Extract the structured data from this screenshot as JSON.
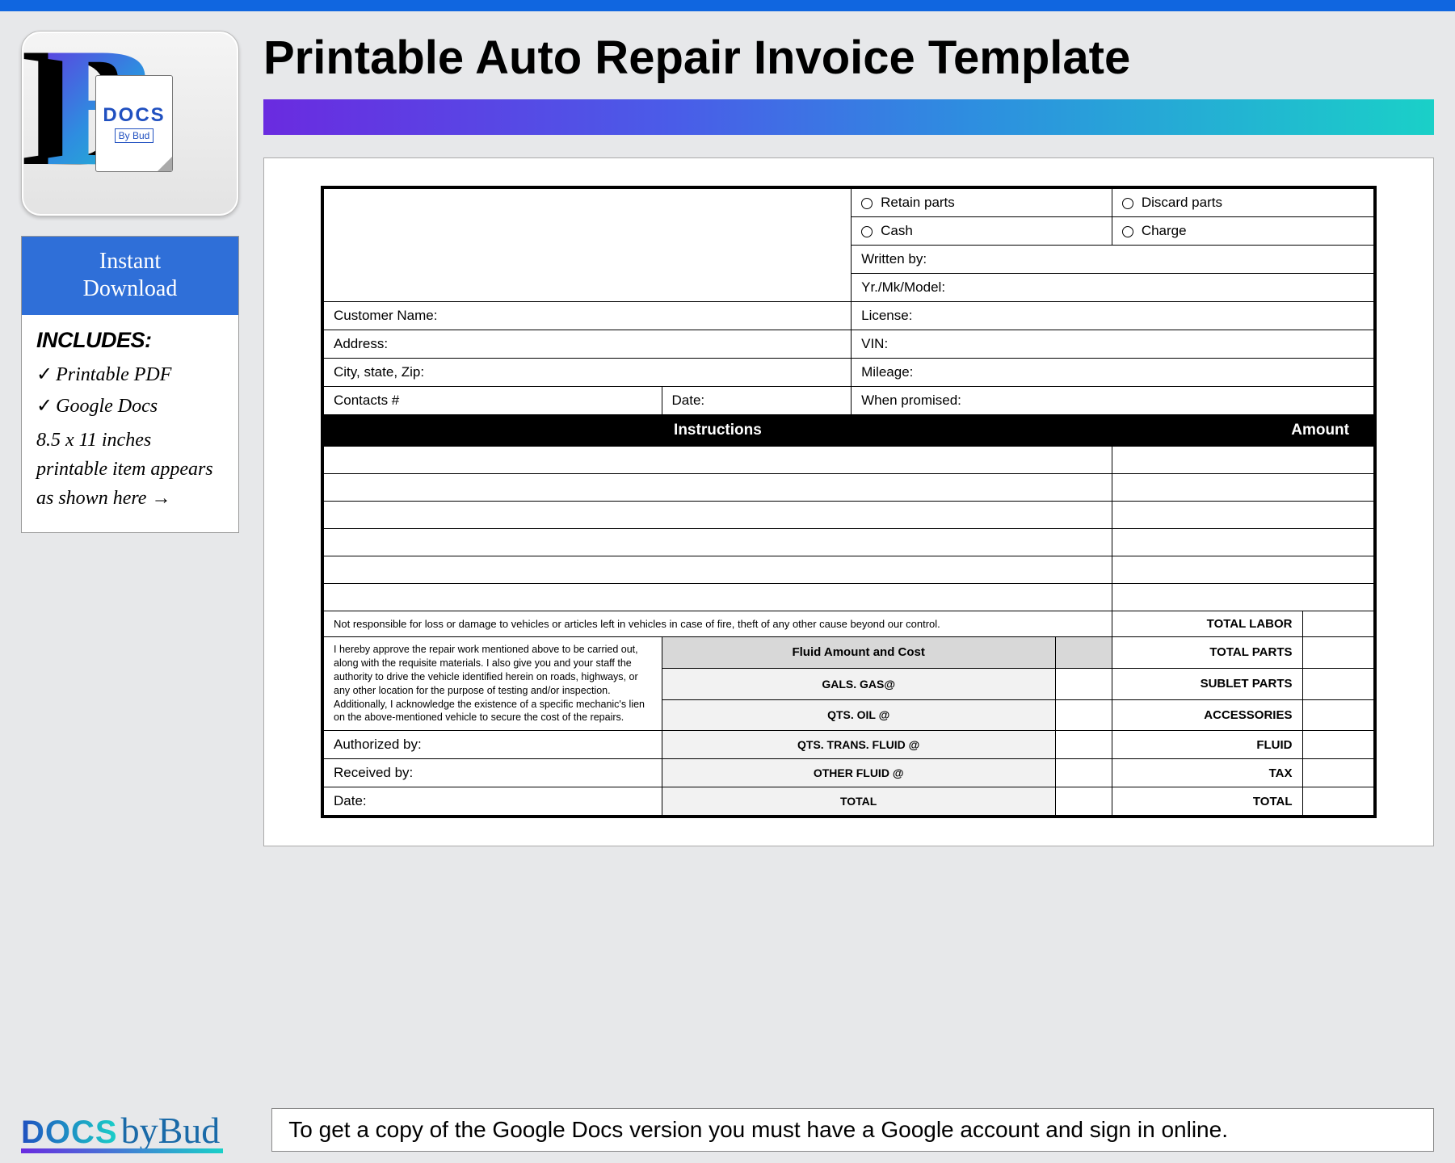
{
  "header": {
    "title": "Printable Auto Repair Invoice Template"
  },
  "logo": {
    "docs": "DOCS",
    "bybud": "By Bud"
  },
  "sidebar": {
    "instant_download": "Instant\nDownload",
    "includes_header": "INCLUDES:",
    "items": [
      "Printable PDF",
      "Google Docs"
    ],
    "dimensions": "8.5 x 11 inches printable item appears as shown here →"
  },
  "invoice": {
    "options": {
      "retain": "Retain parts",
      "discard": "Discard parts",
      "cash": "Cash",
      "charge": "Charge"
    },
    "fields": {
      "written_by": "Written by:",
      "yr_mk_model": "Yr./Mk/Model:",
      "customer_name": "Customer Name:",
      "license": "License:",
      "address": "Address:",
      "vin": "VIN:",
      "city_state_zip": "City, state, Zip:",
      "mileage": "Mileage:",
      "contacts": "Contacts #",
      "date": "Date:",
      "when_promised": "When promised:"
    },
    "headers": {
      "instructions": "Instructions",
      "amount": "Amount"
    },
    "not_responsible": "Not responsible for loss or damage to vehicles or articles left in vehicles in case of fire, theft of any other cause beyond our control.",
    "disclaimer": "I hereby approve the repair work mentioned above to be carried out, along with the requisite materials. I also give you and your staff the authority to drive the vehicle identified herein on roads, highways, or any other location for the purpose of testing and/or inspection. Additionally, I acknowledge the existence of a specific mechanic's lien on the above-mentioned vehicle to secure the cost of the repairs.",
    "fluids": {
      "header": "Fluid Amount and Cost",
      "gas": "GALS. GAS@",
      "oil": "QTS. OIL @",
      "trans": "QTS. TRANS. FLUID @",
      "other": "OTHER FLUID @",
      "total": "TOTAL"
    },
    "totals": {
      "labor": "TOTAL LABOR",
      "parts": "TOTAL PARTS",
      "sublet": "SUBLET PARTS",
      "accessories": "ACCESSORIES",
      "fluid": "FLUID",
      "tax": "TAX",
      "total": "TOTAL"
    },
    "signatures": {
      "authorized": "Authorized by:",
      "received": "Received by:",
      "date": "Date:"
    }
  },
  "footer": {
    "docs": "DOCS",
    "bybud": "byBud",
    "note": "To get a copy of the Google Docs version you must have a Google account and sign in online."
  }
}
